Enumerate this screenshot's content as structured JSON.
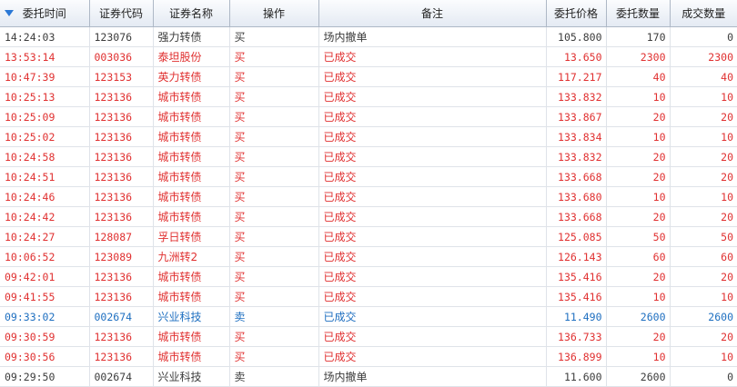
{
  "table": {
    "columns": [
      "委托时间",
      "证券代码",
      "证券名称",
      "操作",
      "备注",
      "委托价格",
      "委托数量",
      "成交数量"
    ],
    "rows": [
      {
        "time": "14:24:03",
        "code": "123076",
        "name": "强力转债",
        "op": "买",
        "note": "场内撤单",
        "price": "105.800",
        "qty": "170",
        "filled": "0",
        "color": "gray"
      },
      {
        "time": "13:53:14",
        "code": "003036",
        "name": "泰坦股份",
        "op": "买",
        "note": "已成交",
        "price": "13.650",
        "qty": "2300",
        "filled": "2300",
        "color": "red"
      },
      {
        "time": "10:47:39",
        "code": "123153",
        "name": "英力转债",
        "op": "买",
        "note": "已成交",
        "price": "117.217",
        "qty": "40",
        "filled": "40",
        "color": "red"
      },
      {
        "time": "10:25:13",
        "code": "123136",
        "name": "城市转债",
        "op": "买",
        "note": "已成交",
        "price": "133.832",
        "qty": "10",
        "filled": "10",
        "color": "red"
      },
      {
        "time": "10:25:09",
        "code": "123136",
        "name": "城市转债",
        "op": "买",
        "note": "已成交",
        "price": "133.867",
        "qty": "20",
        "filled": "20",
        "color": "red"
      },
      {
        "time": "10:25:02",
        "code": "123136",
        "name": "城市转债",
        "op": "买",
        "note": "已成交",
        "price": "133.834",
        "qty": "10",
        "filled": "10",
        "color": "red"
      },
      {
        "time": "10:24:58",
        "code": "123136",
        "name": "城市转债",
        "op": "买",
        "note": "已成交",
        "price": "133.832",
        "qty": "20",
        "filled": "20",
        "color": "red"
      },
      {
        "time": "10:24:51",
        "code": "123136",
        "name": "城市转债",
        "op": "买",
        "note": "已成交",
        "price": "133.668",
        "qty": "20",
        "filled": "20",
        "color": "red"
      },
      {
        "time": "10:24:46",
        "code": "123136",
        "name": "城市转债",
        "op": "买",
        "note": "已成交",
        "price": "133.680",
        "qty": "10",
        "filled": "10",
        "color": "red"
      },
      {
        "time": "10:24:42",
        "code": "123136",
        "name": "城市转债",
        "op": "买",
        "note": "已成交",
        "price": "133.668",
        "qty": "20",
        "filled": "20",
        "color": "red"
      },
      {
        "time": "10:24:27",
        "code": "128087",
        "name": "孚日转债",
        "op": "买",
        "note": "已成交",
        "price": "125.085",
        "qty": "50",
        "filled": "50",
        "color": "red"
      },
      {
        "time": "10:06:52",
        "code": "123089",
        "name": "九洲转2",
        "op": "买",
        "note": "已成交",
        "price": "126.143",
        "qty": "60",
        "filled": "60",
        "color": "red"
      },
      {
        "time": "09:42:01",
        "code": "123136",
        "name": "城市转债",
        "op": "买",
        "note": "已成交",
        "price": "135.416",
        "qty": "20",
        "filled": "20",
        "color": "red"
      },
      {
        "time": "09:41:55",
        "code": "123136",
        "name": "城市转债",
        "op": "买",
        "note": "已成交",
        "price": "135.416",
        "qty": "10",
        "filled": "10",
        "color": "red"
      },
      {
        "time": "09:33:02",
        "code": "002674",
        "name": "兴业科技",
        "op": "卖",
        "note": "已成交",
        "price": "11.490",
        "qty": "2600",
        "filled": "2600",
        "color": "blue"
      },
      {
        "time": "09:30:59",
        "code": "123136",
        "name": "城市转债",
        "op": "买",
        "note": "已成交",
        "price": "136.733",
        "qty": "20",
        "filled": "20",
        "color": "red"
      },
      {
        "time": "09:30:56",
        "code": "123136",
        "name": "城市转债",
        "op": "买",
        "note": "已成交",
        "price": "136.899",
        "qty": "10",
        "filled": "10",
        "color": "red"
      },
      {
        "time": "09:29:50",
        "code": "002674",
        "name": "兴业科技",
        "op": "卖",
        "note": "场内撤单",
        "price": "11.600",
        "qty": "2600",
        "filled": "0",
        "color": "gray"
      }
    ]
  },
  "icons": {
    "sort": "sort-descending-icon"
  },
  "colors": {
    "gray": "#3c3c3c",
    "red": "#e03030",
    "blue": "#1e6fc0",
    "sort_accent": "#2b78d6"
  }
}
